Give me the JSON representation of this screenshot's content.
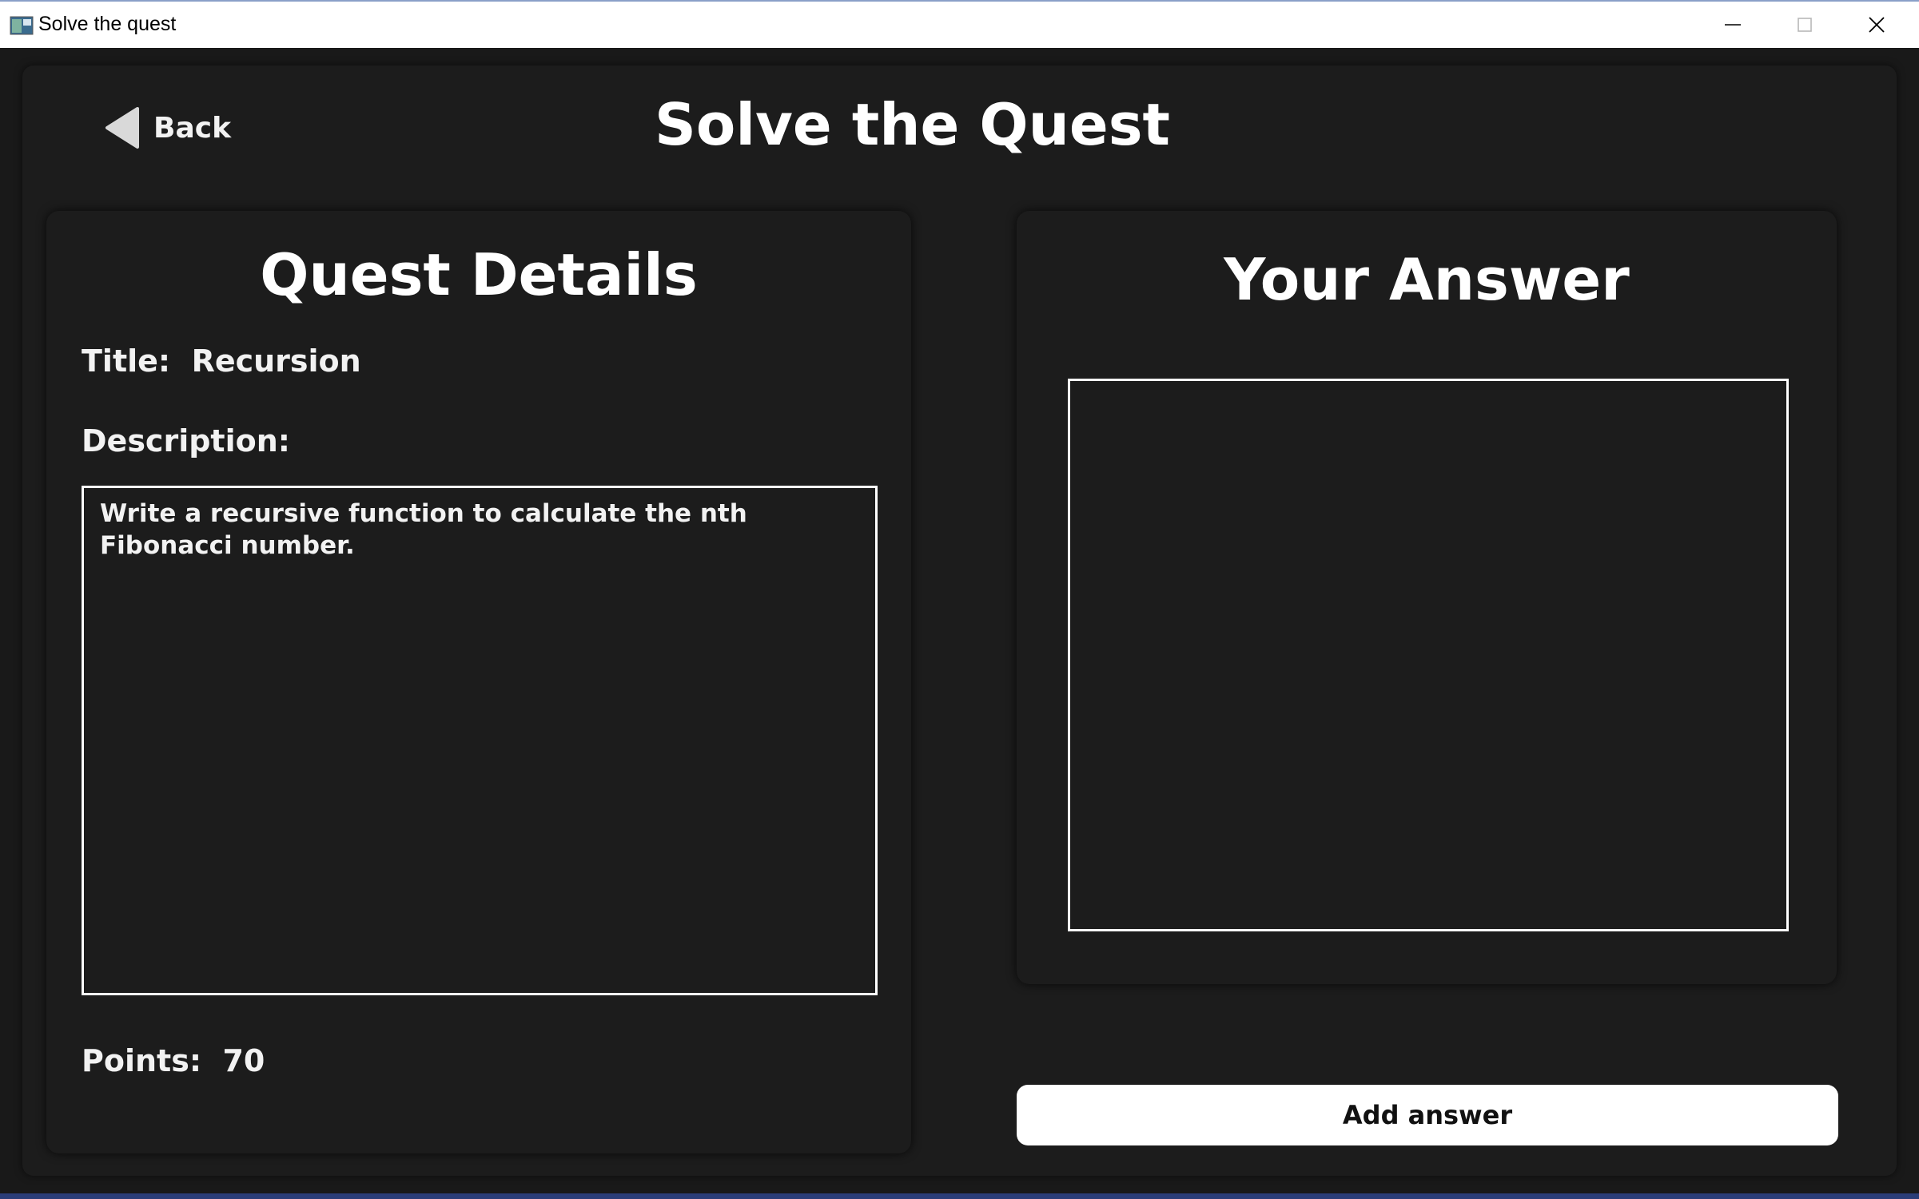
{
  "window": {
    "title": "Solve the quest",
    "controls": [
      "minimize-icon",
      "maximize-icon",
      "close-icon"
    ]
  },
  "header": {
    "back_label": "Back",
    "title": "Solve the Quest"
  },
  "details": {
    "heading": "Quest Details",
    "title_label": "Title:  Recursion",
    "description_label": "Description:",
    "description_text": "Write a recursive function to calculate the nth Fibonacci number.",
    "points_label": "Points:  70"
  },
  "answer": {
    "heading": "Your Answer",
    "value": "",
    "submit_label": "Add answer"
  },
  "colors": {
    "background": "#1c1c1c",
    "text": "#ffffff",
    "button_bg": "#ffffff",
    "button_text": "#111111"
  }
}
